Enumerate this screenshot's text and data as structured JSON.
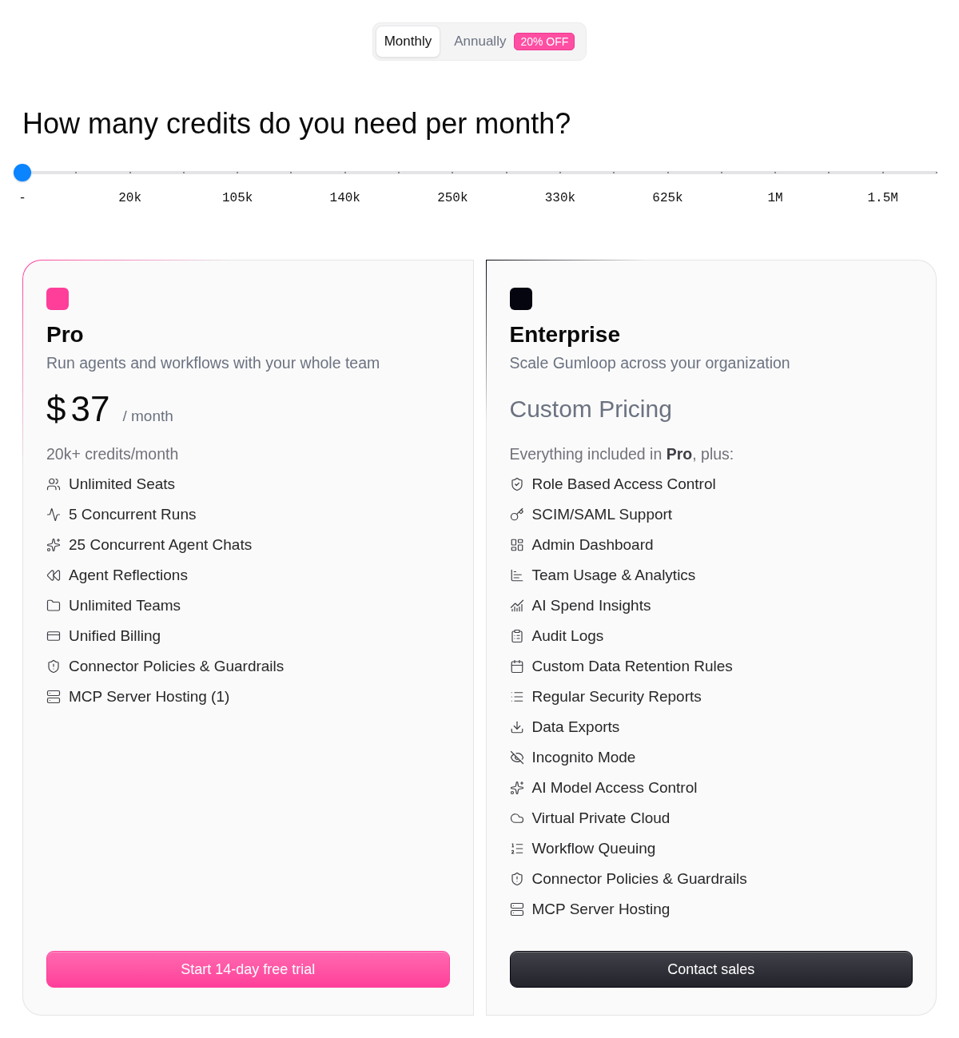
{
  "billing_toggle": {
    "options": [
      {
        "label": "Monthly",
        "selected": true
      },
      {
        "label": "Annually",
        "selected": false,
        "badge": "20% OFF"
      }
    ]
  },
  "credits": {
    "question": "How many credits do you need per month?",
    "slider": {
      "level": 0,
      "labels": [
        "-",
        "20k",
        "105k",
        "140k",
        "250k",
        "330k",
        "625k",
        "1M",
        "1.5M"
      ]
    }
  },
  "plans": [
    {
      "kind": "priced",
      "name": "Pro",
      "color": "#ff3e9a",
      "subtitle": "Run agents and workflows with your whole team",
      "price": {
        "currency": "$",
        "amount": "37",
        "period": "/ month"
      },
      "features_intro": "20k+ credits/month",
      "features": [
        "Unlimited Seats",
        "5 Concurrent Runs",
        "25 Concurrent Agent Chats",
        "Agent Reflections",
        "Unlimited Teams",
        "Unified Billing",
        "Connector Policies & Guardrails",
        "MCP Server Hosting (1)"
      ],
      "button": "Start 14-day free trial"
    },
    {
      "kind": "custom",
      "name": "Enterprise",
      "color": "#05050f",
      "subtitle": "Scale Gumloop across your organization",
      "price": {
        "label": "Custom Pricing"
      },
      "features_intro": "Everything included in **Pro**, plus:",
      "features": [
        "Role Based Access Control",
        "SCIM/SAML Support",
        "Admin Dashboard",
        "Team Usage & Analytics",
        "AI Spend Insights",
        "Audit Logs",
        "Custom Data Retention Rules",
        "Regular Security Reports",
        "Data Exports",
        "Incognito Mode",
        "AI Model Access Control",
        "Virtual Private Cloud",
        "Workflow Queuing",
        "Connector Policies & Guardrails",
        "MCP Server Hosting"
      ],
      "button": "Contact sales"
    }
  ]
}
